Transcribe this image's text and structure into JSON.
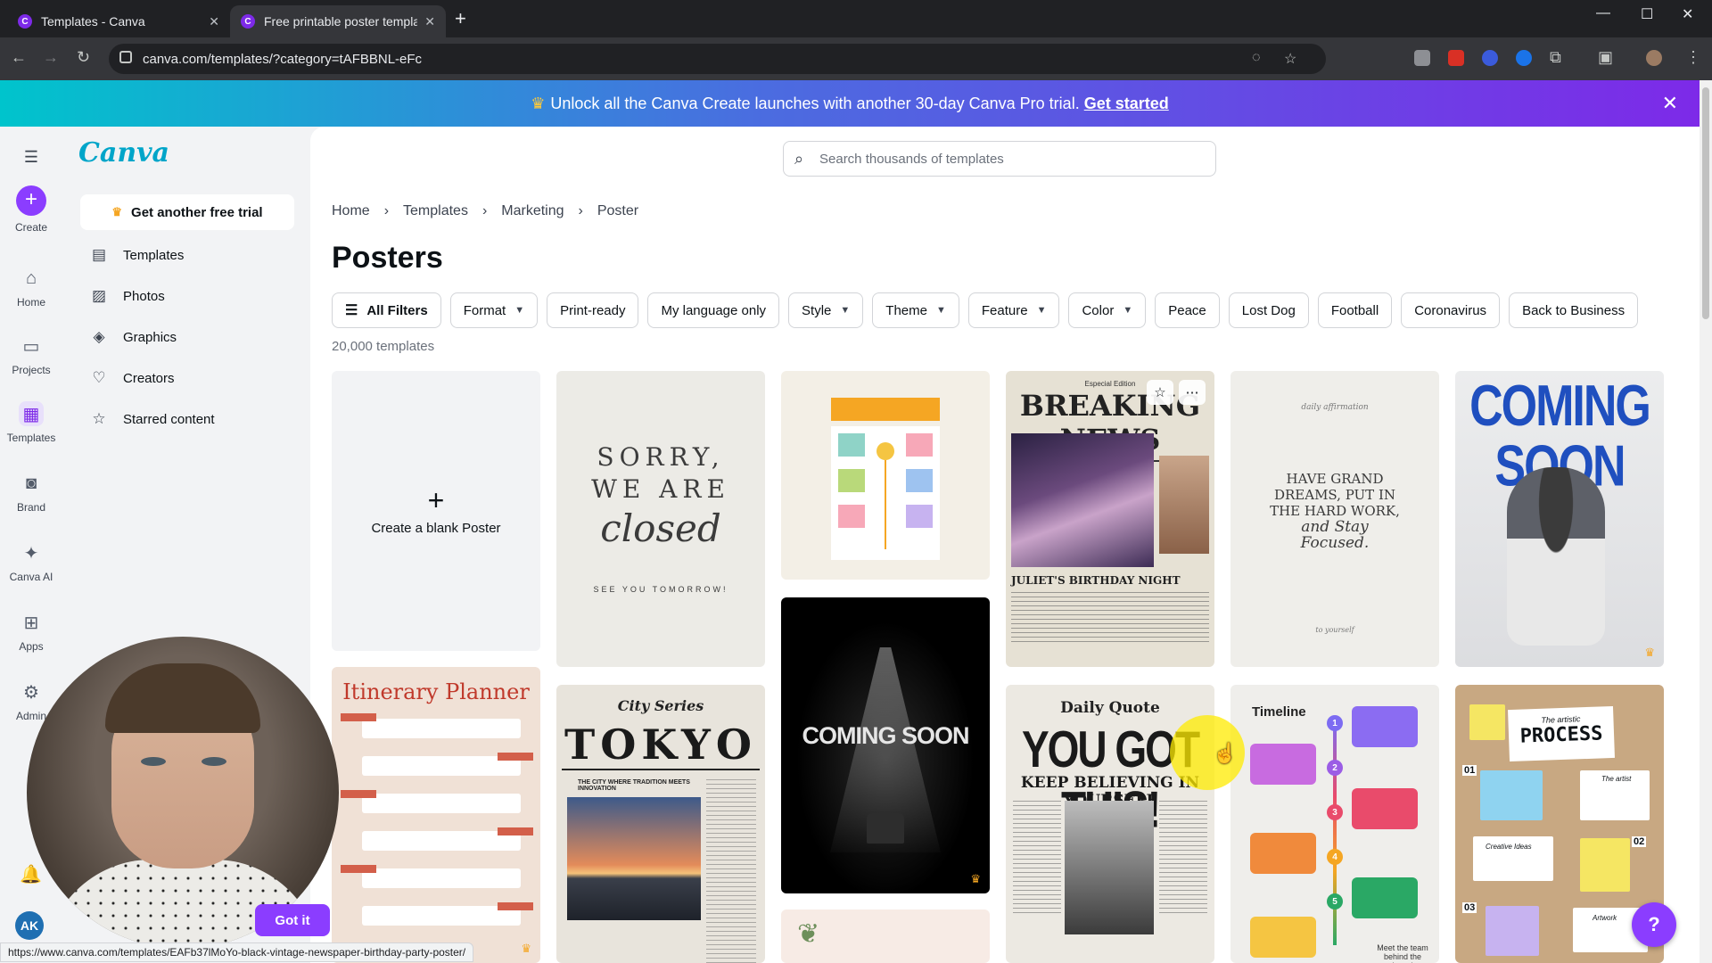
{
  "browser": {
    "tabs": [
      {
        "label": "Templates - Canva",
        "active": false
      },
      {
        "label": "Free printable poster template",
        "active": true
      }
    ],
    "url": "canva.com/templates/?category=tAFBBNL-eFc",
    "status_url": "https://www.canva.com/templates/EAFb37lMoYo-black-vintage-newspaper-birthday-party-poster/"
  },
  "banner": {
    "text": "Unlock all the Canva Create launches with another 30-day Canva Pro trial.",
    "cta": "Get started"
  },
  "rail": {
    "create": "Create",
    "home": "Home",
    "projects": "Projects",
    "templates": "Templates",
    "brand": "Brand",
    "canva_ai": "Canva AI",
    "apps": "Apps",
    "admin": "Admin",
    "avatar_initials": "AK"
  },
  "sidebar": {
    "logo": "Canva",
    "trial_button": "Get another free trial",
    "items": [
      {
        "label": "Templates",
        "icon": "template-icon"
      },
      {
        "label": "Photos",
        "icon": "photo-icon"
      },
      {
        "label": "Graphics",
        "icon": "graphics-icon"
      },
      {
        "label": "Creators",
        "icon": "creators-icon"
      },
      {
        "label": "Starred content",
        "icon": "star-icon"
      }
    ]
  },
  "search": {
    "placeholder": "Search thousands of templates"
  },
  "breadcrumb": [
    "Home",
    "Templates",
    "Marketing",
    "Poster"
  ],
  "title": "Posters",
  "filters": {
    "all": "All Filters",
    "dropdowns": [
      "Format",
      "Print-ready",
      "My language only",
      "Style",
      "Theme",
      "Feature",
      "Color"
    ],
    "tags": [
      "Peace",
      "Lost Dog",
      "Football",
      "Coronavirus",
      "Back to Business"
    ]
  },
  "count": "20,000 templates",
  "blank_card": "Create a blank Poster",
  "templates": {
    "closed": {
      "l1": "SORRY,",
      "l2": "WE ARE",
      "l3": "closed",
      "l4": "SEE YOU TOMORROW!"
    },
    "news": {
      "top": "Especial Edition",
      "head": "BREAKING NEWS",
      "sub": "JULIET'S BIRTHDAY NIGHT"
    },
    "dreams": {
      "small": "daily affirmation",
      "quote": "HAVE GRAND DREAMS, PUT IN THE HARD WORK,",
      "italic": "and Stay Focused.",
      "sig": "to yourself"
    },
    "coming_soon": {
      "headline": "COMING SOON"
    },
    "itinerary": {
      "title": "Itinerary Planner"
    },
    "tokyo": {
      "series": "City Series",
      "title": "TOKYO",
      "caption": "THE CITY WHERE TRADITION MEETS INNOVATION"
    },
    "dark": {
      "text": "COMING SOON"
    },
    "quote": {
      "label": "Daily Quote",
      "headline": "YOU GOT THIS!",
      "sub": "KEEP BELIEVING IN YOURSELF"
    },
    "timeline": {
      "title": "Timeline",
      "footer": "Meet the team behind the brand"
    },
    "process": {
      "top": "The artistic",
      "title": "PROCESS",
      "n1": "01",
      "n2": "02",
      "n3": "03",
      "lab1": "The artist",
      "lab2": "Creative Ideas",
      "lab3": "Artwork"
    }
  },
  "popups": {
    "got_it": "Got it",
    "help": "?"
  }
}
